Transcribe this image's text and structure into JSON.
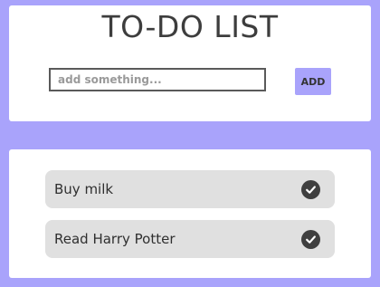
{
  "header": {
    "title": "TO-DO LIST",
    "input_placeholder": "add something...",
    "input_value": "",
    "add_label": "ADD"
  },
  "todos": [
    {
      "label": "Buy milk",
      "icon": "check-circle-icon"
    },
    {
      "label": "Read Harry Potter",
      "icon": "check-circle-icon"
    }
  ],
  "colors": {
    "background": "#a9a3fb",
    "accent": "#a9a3fb",
    "item_background": "#e0e0e0",
    "check_icon": "#3f3f3f"
  }
}
